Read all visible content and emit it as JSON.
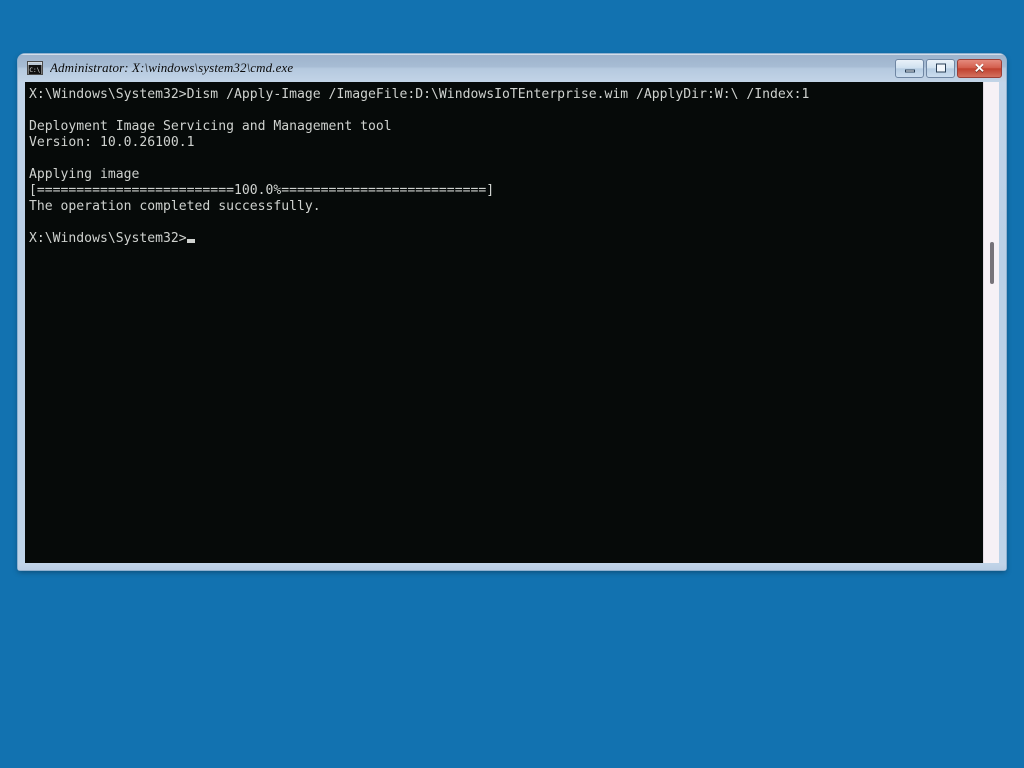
{
  "desktop": {
    "background_color": "#1272b0"
  },
  "window": {
    "title": "Administrator: X:\\windows\\system32\\cmd.exe",
    "icon": "cmd-console-icon",
    "frame_color": "#bfd4e9",
    "titlebar_gradient_top": "#9cb2cb",
    "titlebar_gradient_bottom": "#c2d4e7",
    "controls": {
      "minimize_label": "–",
      "maximize_label": "□",
      "close_label": "✕"
    }
  },
  "console": {
    "background_color": "#060a09",
    "foreground_color": "#cfd2cf",
    "prompt_path": "X:\\Windows\\System32>",
    "lines": [
      "X:\\Windows\\System32>Dism /Apply-Image /ImageFile:D:\\WindowsIoTEnterprise.wim /ApplyDir:W:\\ /Index:1",
      "",
      "Deployment Image Servicing and Management tool",
      "Version: 10.0.26100.1",
      "",
      "Applying image",
      "[=========================100.0%==========================]",
      "The operation completed successfully.",
      "",
      "X:\\Windows\\System32>"
    ],
    "command": "Dism /Apply-Image /ImageFile:D:\\WindowsIoTEnterprise.wim /ApplyDir:W:\\ /Index:1",
    "tool_name": "Deployment Image Servicing and Management tool",
    "version": "Version: 10.0.26100.1",
    "status_applying": "Applying image",
    "progress_percent": "100.0%",
    "progress_bar": "[=========================100.0%==========================]",
    "result_message": "The operation completed successfully.",
    "cursor_visible": true
  },
  "scrollbar": {
    "track_color": "#f6f1f6",
    "thumb_color": "#77737a"
  }
}
